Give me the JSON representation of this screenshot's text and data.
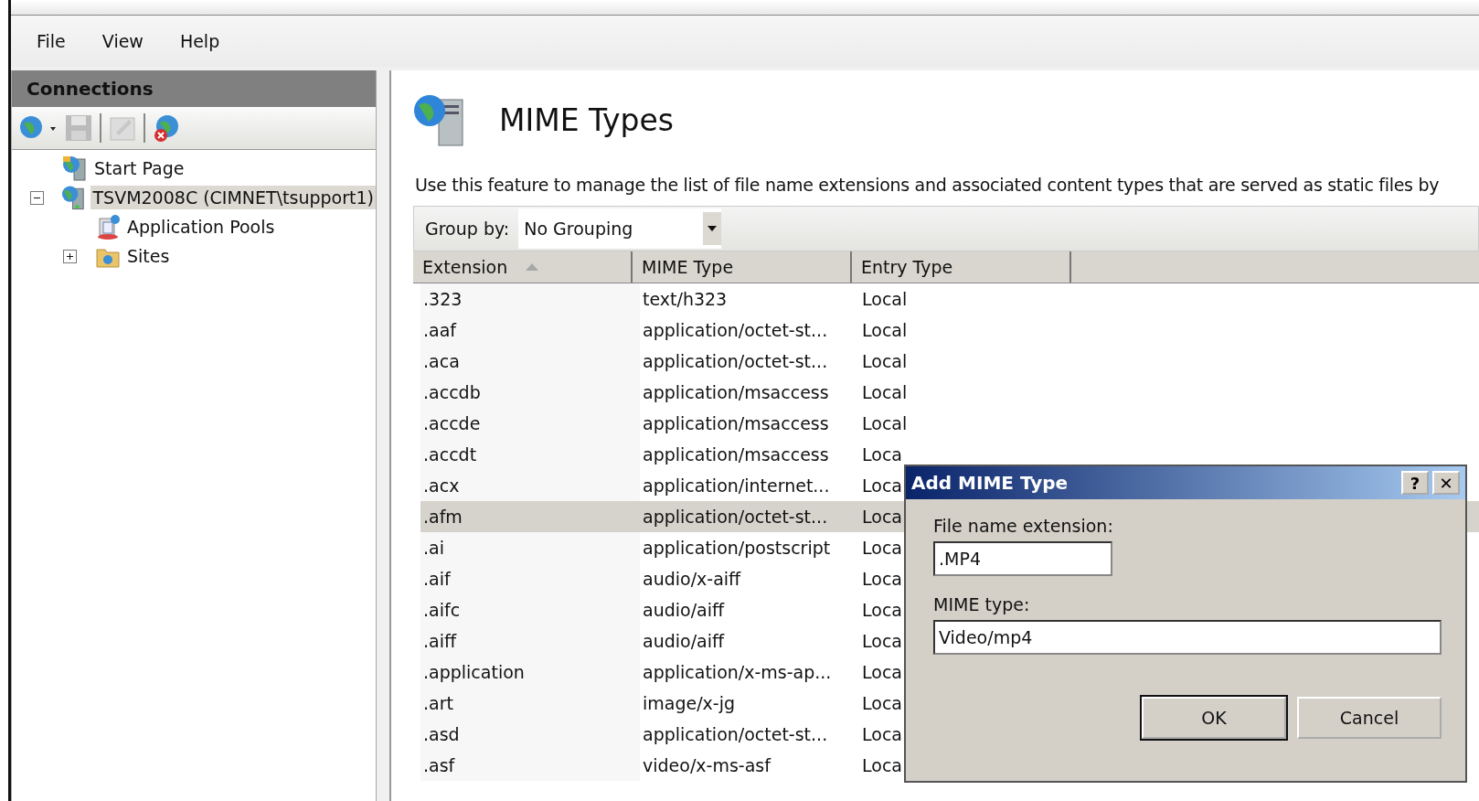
{
  "menu": [
    "File",
    "View",
    "Help"
  ],
  "connections": {
    "title": "Connections",
    "tree": [
      {
        "label": "Start Page",
        "kind": "start",
        "selected": false
      },
      {
        "label": "TSVM2008C (CIMNET\\tsupport1)",
        "kind": "server",
        "selected": true,
        "expanded": true,
        "children": [
          {
            "label": "Application Pools",
            "kind": "pools",
            "selected": false
          },
          {
            "label": "Sites",
            "kind": "sites",
            "selected": false,
            "expanded": false
          }
        ]
      }
    ]
  },
  "feature": {
    "title": "MIME Types",
    "description": "Use this feature to manage the list of file name extensions and associated content types that are served as static files by",
    "group_by": {
      "label": "Group by:",
      "value": "No Grouping"
    },
    "table": {
      "columns": [
        {
          "label": "Extension",
          "sorted": true
        },
        {
          "label": "MIME Type",
          "sorted": false
        },
        {
          "label": "Entry Type",
          "sorted": false
        }
      ],
      "rows": [
        {
          "cells": [
            ".323",
            "text/h323",
            "Local"
          ],
          "selected": false
        },
        {
          "cells": [
            ".aaf",
            "application/octet-st...",
            "Local"
          ],
          "selected": false
        },
        {
          "cells": [
            ".aca",
            "application/octet-st...",
            "Local"
          ],
          "selected": false
        },
        {
          "cells": [
            ".accdb",
            "application/msaccess",
            "Local"
          ],
          "selected": false
        },
        {
          "cells": [
            ".accde",
            "application/msaccess",
            "Local"
          ],
          "selected": false
        },
        {
          "cells": [
            ".accdt",
            "application/msaccess",
            "Loca"
          ],
          "selected": false
        },
        {
          "cells": [
            ".acx",
            "application/internet...",
            "Loca"
          ],
          "selected": false
        },
        {
          "cells": [
            ".afm",
            "application/octet-st...",
            "Loca"
          ],
          "selected": true
        },
        {
          "cells": [
            ".ai",
            "application/postscript",
            "Loca"
          ],
          "selected": false
        },
        {
          "cells": [
            ".aif",
            "audio/x-aiff",
            "Loca"
          ],
          "selected": false
        },
        {
          "cells": [
            ".aifc",
            "audio/aiff",
            "Loca"
          ],
          "selected": false
        },
        {
          "cells": [
            ".aiff",
            "audio/aiff",
            "Loca"
          ],
          "selected": false
        },
        {
          "cells": [
            ".application",
            "application/x-ms-ap...",
            "Loca"
          ],
          "selected": false
        },
        {
          "cells": [
            ".art",
            "image/x-jg",
            "Loca"
          ],
          "selected": false
        },
        {
          "cells": [
            ".asd",
            "application/octet-st...",
            "Loca"
          ],
          "selected": false
        },
        {
          "cells": [
            ".asf",
            "video/x-ms-asf",
            "Loca"
          ],
          "selected": false
        }
      ]
    }
  },
  "dialog": {
    "title": "Add MIME Type",
    "help": "?",
    "close": "✕",
    "fields": [
      {
        "label": "File name extension:",
        "value": ".MP4"
      },
      {
        "label": "MIME type:",
        "value": "Video/mp4"
      }
    ],
    "buttons": [
      "OK",
      "Cancel"
    ]
  }
}
